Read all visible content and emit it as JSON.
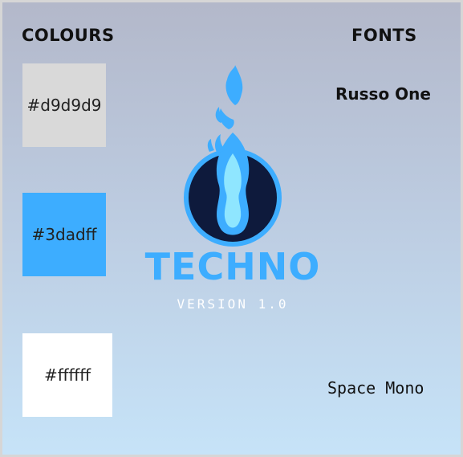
{
  "headings": {
    "colours": "COLOURS",
    "fonts": "FONTS"
  },
  "colours": [
    {
      "label": "#d9d9d9",
      "hex": "#d9d9d9"
    },
    {
      "label": "#3dadff",
      "hex": "#3dadff"
    },
    {
      "label": "#ffffff",
      "hex": "#ffffff"
    }
  ],
  "fonts": {
    "primary": "Russo One",
    "secondary": "Space Mono"
  },
  "logo": {
    "name": "TECHNO",
    "version": "VERSION 1.0",
    "icon": "flame-icon",
    "colors": {
      "flame_outer": "#3dadff",
      "flame_inner": "#8fe6ff",
      "circle_fill": "#0e1a3c",
      "circle_ring": "#3dadff"
    }
  }
}
